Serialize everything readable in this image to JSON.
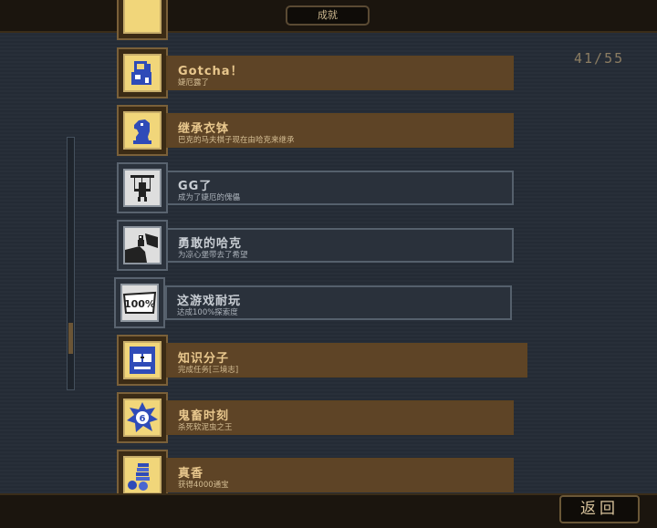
{
  "header": {
    "title": "成就"
  },
  "progress": {
    "counter": "41/55"
  },
  "achievements": [
    {
      "name": "Gotcha！",
      "desc": "婕厄露了",
      "unlocked": true,
      "icon": "knight-portrait-icon"
    },
    {
      "name": "继承衣钵",
      "desc": "巴克的马夫棋子现在由哈克来继承",
      "unlocked": true,
      "icon": "chess-knight-icon"
    },
    {
      "name": "GG了",
      "desc": "成为了婕厄的傀儡",
      "unlocked": false,
      "icon": "puppet-icon"
    },
    {
      "name": "勇敢的哈克",
      "desc": "为凉心堡带去了希望",
      "unlocked": false,
      "icon": "cliff-hero-icon"
    },
    {
      "name": "这游戏耐玩",
      "desc": "达成100%探索度",
      "unlocked": false,
      "icon": "hundred-percent-icon"
    },
    {
      "name": "知识分子",
      "desc": "完成任务[三境志]",
      "unlocked": true,
      "icon": "scholar-face-icon"
    },
    {
      "name": "鬼畜时刻",
      "desc": "杀死软泥虫之王",
      "unlocked": true,
      "icon": "slime-king-icon"
    },
    {
      "name": "真香",
      "desc": "获得4000通宝",
      "unlocked": true,
      "icon": "coin-stack-icon"
    }
  ],
  "footer": {
    "back_label": "返回"
  },
  "colors": {
    "unlocked_panel": "#5e4426",
    "locked_panel": "#2a313b",
    "unlocked_icon_bg": "#f1d67a",
    "locked_icon_bg": "#dedede"
  }
}
